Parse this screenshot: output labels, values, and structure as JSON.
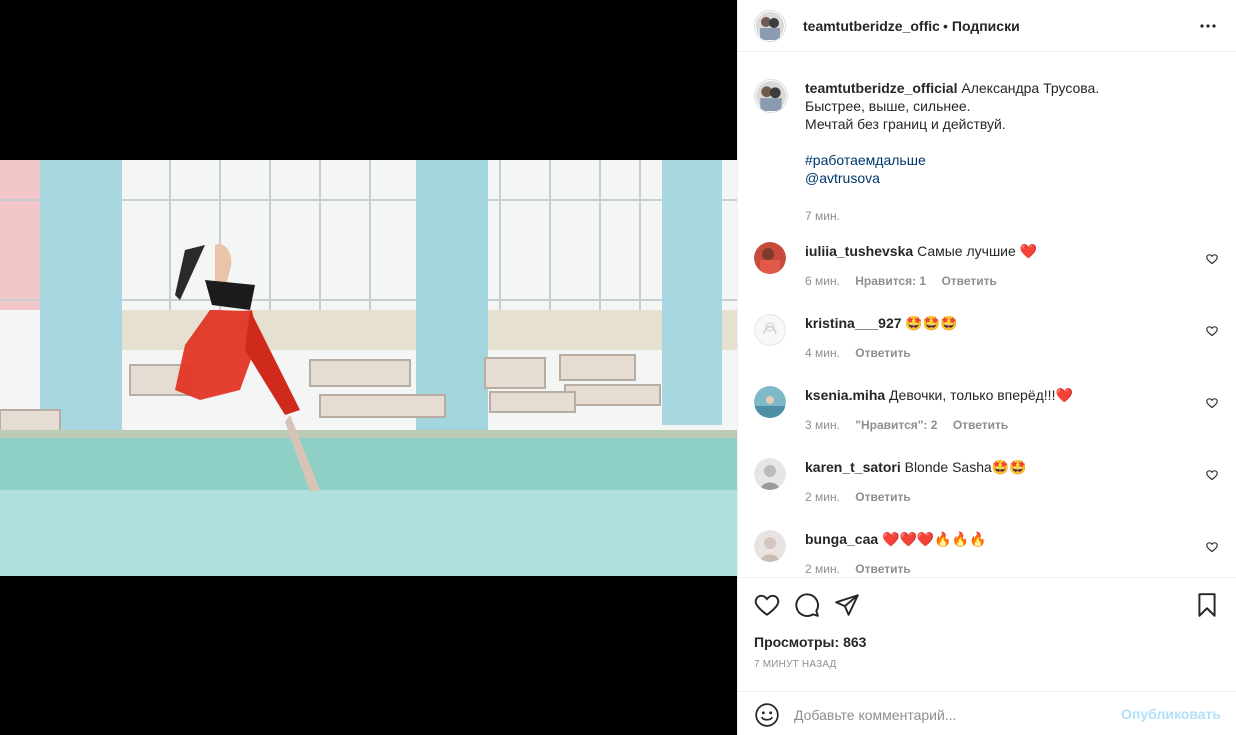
{
  "post": {
    "author": "teamtutberidze_official",
    "follow_status": "Подписки",
    "caption_lines": [
      "Александра Трусова.",
      "Быстрее, выше, сильнее.",
      "Мечтай без границ и действуй."
    ],
    "hashtag": "#работаемдальше",
    "mention": "@avtrusova",
    "caption_time": "7 мин.",
    "views_label": "Просмотры:",
    "views_count": "863",
    "posted_ago": "7 МИНУТ НАЗАД"
  },
  "comments": [
    {
      "user": "iuliia_tushevska",
      "text": "Самые лучшие ❤️",
      "time": "6 мин.",
      "likes": "Нравится: 1",
      "reply": "Ответить"
    },
    {
      "user": "kristina___927",
      "text": "🤩🤩🤩",
      "time": "4 мин.",
      "likes": "",
      "reply": "Ответить"
    },
    {
      "user": "ksenia.miha",
      "text": "Девочки, только вперёд!!!❤️",
      "time": "3 мин.",
      "likes": "\"Нравится\": 2",
      "reply": "Ответить"
    },
    {
      "user": "karen_t_satori",
      "text": "Blonde Sasha🤩🤩",
      "time": "2 мин.",
      "likes": "",
      "reply": "Ответить"
    },
    {
      "user": "bunga_caa",
      "text": "❤️❤️❤️🔥🔥🔥",
      "time": "2 мин.",
      "likes": "",
      "reply": "Ответить"
    }
  ],
  "add_comment": {
    "placeholder": "Добавьте комментарий...",
    "publish": "Опубликовать"
  },
  "icons": {
    "like": "heart-icon",
    "comment": "comment-icon",
    "share": "paper-plane-icon",
    "save": "bookmark-icon",
    "more": "more-horizontal-icon",
    "emoji": "emoji-icon"
  },
  "colors": {
    "link": "#00376b",
    "muted": "#8e8e8e",
    "publish_disabled": "#b2dffc"
  }
}
